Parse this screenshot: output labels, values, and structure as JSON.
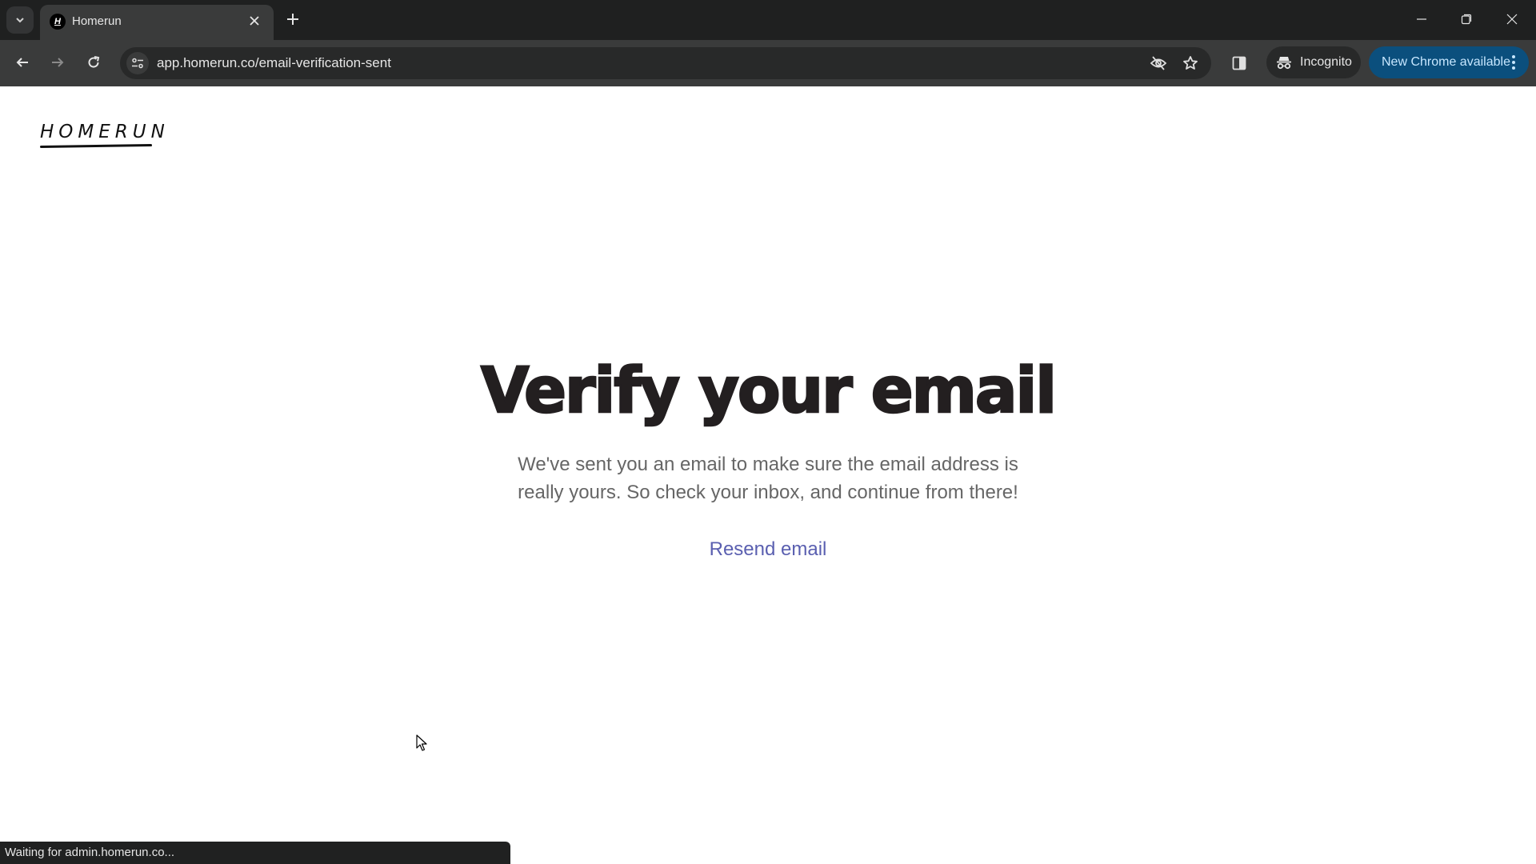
{
  "browser": {
    "tab": {
      "title": "Homerun",
      "favicon_letter": "H",
      "close_icon": "close-icon"
    },
    "new_tab_label": "+",
    "url": "app.homerun.co/email-verification-sent",
    "incognito_label": "Incognito",
    "update_label": "New Chrome available",
    "icons": [
      "tab-search-icon",
      "back-icon",
      "forward-icon",
      "reload-icon",
      "site-info-icon",
      "eye-off-icon",
      "star-icon",
      "side-panel-icon",
      "incognito-icon",
      "more-icon",
      "minimize-icon",
      "maximize-icon",
      "close-window-icon"
    ],
    "colors": {
      "update_chip_bg": "#0b4f7d",
      "update_chip_text": "#c7e7ff"
    }
  },
  "page": {
    "logo": "HOMERUN",
    "heading": "Verify your email",
    "body": "We've sent you an email to make sure the email address is really yours. So check your inbox, and continue from there!",
    "resend_link": "Resend email",
    "colors": {
      "heading": "#231f20",
      "body": "#666666",
      "link": "#5a5fb0"
    }
  },
  "status_bar": {
    "text": "Waiting for admin.homerun.co..."
  }
}
